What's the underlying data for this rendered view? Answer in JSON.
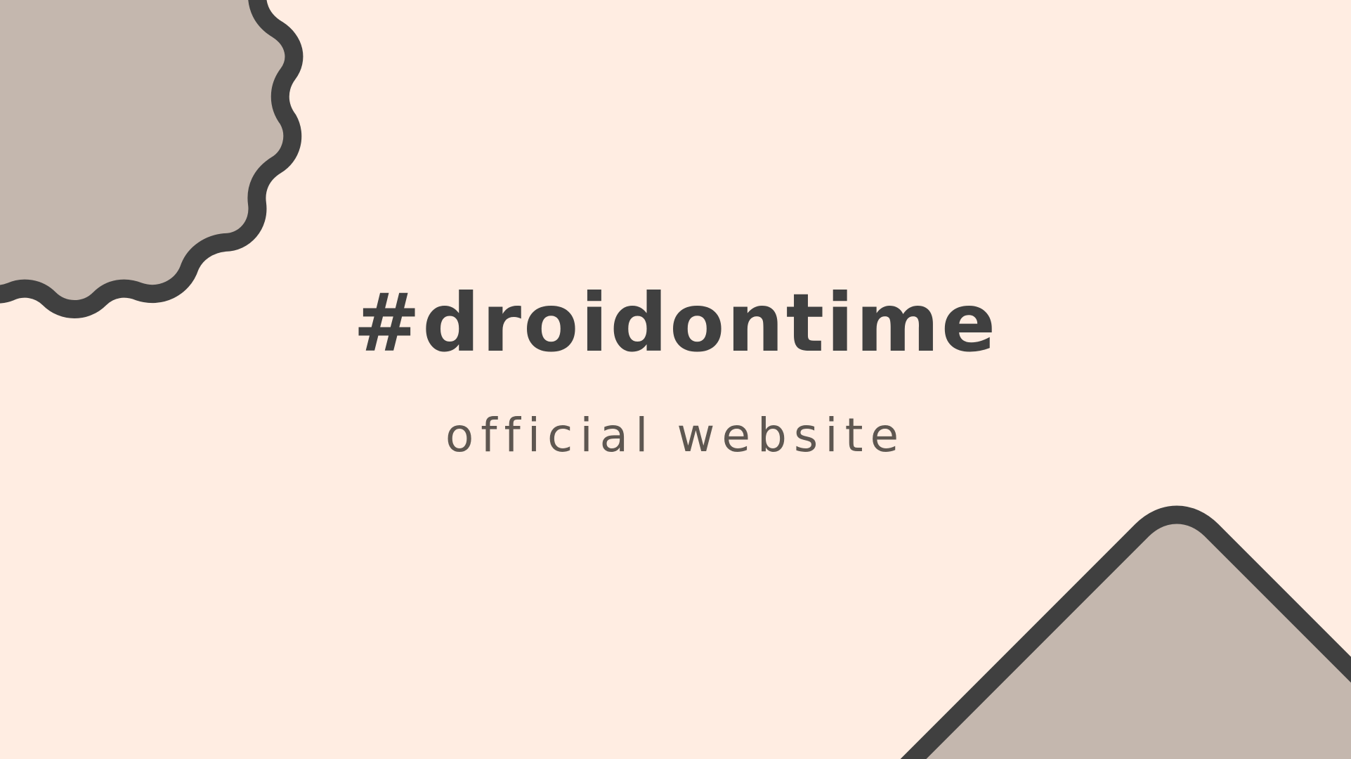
{
  "hero": {
    "title": "#droidontime",
    "subtitle": "official website"
  },
  "colors": {
    "background": "#FFEDE2",
    "shape_fill": "#C4B7AE",
    "shape_outline": "#404040",
    "title": "#404040",
    "subtitle": "#5E5751"
  }
}
